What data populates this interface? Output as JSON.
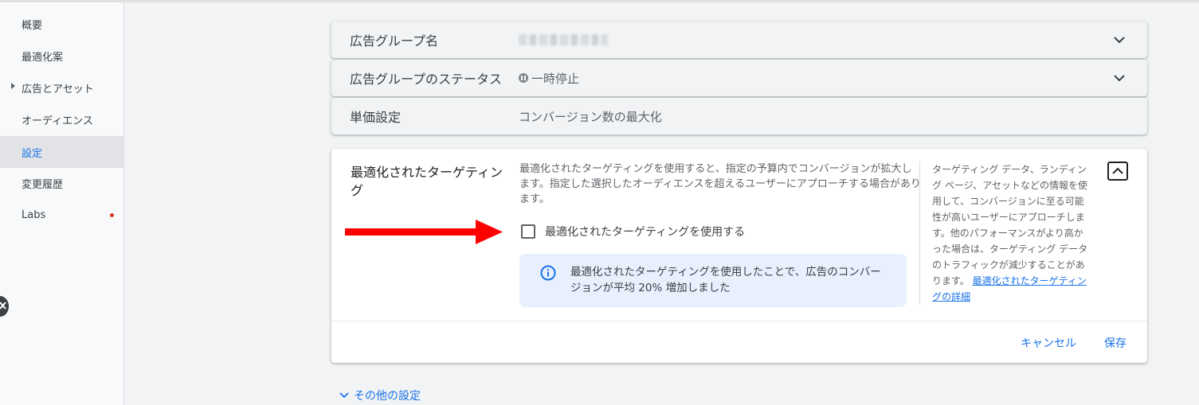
{
  "sidebar": {
    "items": [
      {
        "label": "概要"
      },
      {
        "label": "最適化案"
      },
      {
        "label": "広告とアセット"
      },
      {
        "label": "オーディエンス"
      },
      {
        "label": "設定"
      },
      {
        "label": "変更履歴"
      },
      {
        "label": "Labs"
      }
    ],
    "active_index": 4
  },
  "rows": {
    "ad_group_name": {
      "label": "広告グループ名"
    },
    "ad_group_status": {
      "label": "広告グループのステータス",
      "value": "一時停止"
    },
    "bidding": {
      "label": "単価設定",
      "value": "コンバージョン数の最大化"
    }
  },
  "targeting": {
    "title": "最適化されたターゲティング",
    "description": "最適化されたターゲティングを使用すると、指定の予算内でコンバージョンが拡大します。指定した選択したオーディエンスを超えるユーザーにアプローチする場合があります。",
    "checkbox_label": "最適化されたターゲティングを使用する",
    "checkbox_checked": false,
    "info_text": "最適化されたターゲティングを使用したことで、広告のコンバージョンが平均 20% 増加しました",
    "help_text": "ターゲティング データ、ランディング ページ、アセットなどの情報を使用して、コンバージョンに至る可能性が高いユーザーにアプローチします。他のパフォーマンスがより高かった場合は、ターゲティング データのトラフィックが減少することがあります。",
    "help_link": "最適化されたターゲティングの詳細",
    "cancel_label": "キャンセル",
    "save_label": "保存"
  },
  "more_settings": {
    "label": "その他の設定"
  },
  "colors": {
    "accent": "#1a73e8",
    "arrow": "#ff0000",
    "info_bg": "#e8f0fe",
    "labs_dot": "#d93025"
  }
}
